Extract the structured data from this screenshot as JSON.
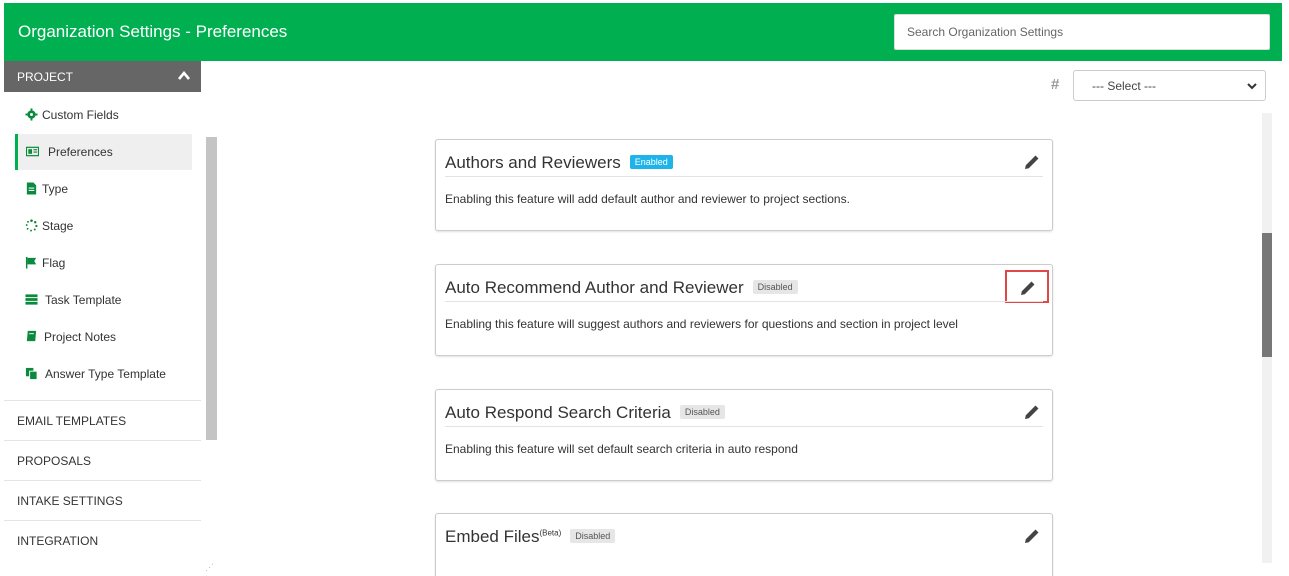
{
  "header": {
    "title": "Organization Settings - Preferences",
    "search_placeholder": "Search Organization Settings"
  },
  "sidebar": {
    "project_label": "PROJECT",
    "items": [
      {
        "label": "Custom Fields",
        "icon": "gear-icon"
      },
      {
        "label": "Preferences",
        "icon": "id-card-icon",
        "active": true
      },
      {
        "label": "Type",
        "icon": "file-icon"
      },
      {
        "label": "Stage",
        "icon": "spinner-icon"
      },
      {
        "label": "Flag",
        "icon": "flag-icon"
      },
      {
        "label": "Task Template",
        "icon": "tasks-icon"
      },
      {
        "label": "Project Notes",
        "icon": "book-icon"
      },
      {
        "label": "Answer Type Template",
        "icon": "copy-icon"
      }
    ],
    "sections": [
      "EMAIL TEMPLATES",
      "PROPOSALS",
      "INTAKE SETTINGS",
      "INTEGRATION"
    ]
  },
  "filter": {
    "hash_symbol": "#",
    "select_value": "--- Select ---"
  },
  "cards": [
    {
      "title": "Authors and Reviewers",
      "badge": "Enabled",
      "description": "Enabling this feature will add default author and reviewer to project sections."
    },
    {
      "title": "Auto Recommend Author and Reviewer",
      "badge": "Disabled",
      "description": "Enabling this feature will suggest authors and reviewers for questions and section in project level"
    },
    {
      "title": "Auto Respond Search Criteria",
      "badge": "Disabled",
      "description": "Enabling this feature will set default search criteria in auto respond"
    },
    {
      "title": "Embed Files",
      "superscript": "(Beta)",
      "badge": "Disabled",
      "description": ""
    }
  ],
  "colors": {
    "brand_green": "#00b050",
    "enabled_badge": "#1eb4ea",
    "highlight_border": "#e04848"
  }
}
